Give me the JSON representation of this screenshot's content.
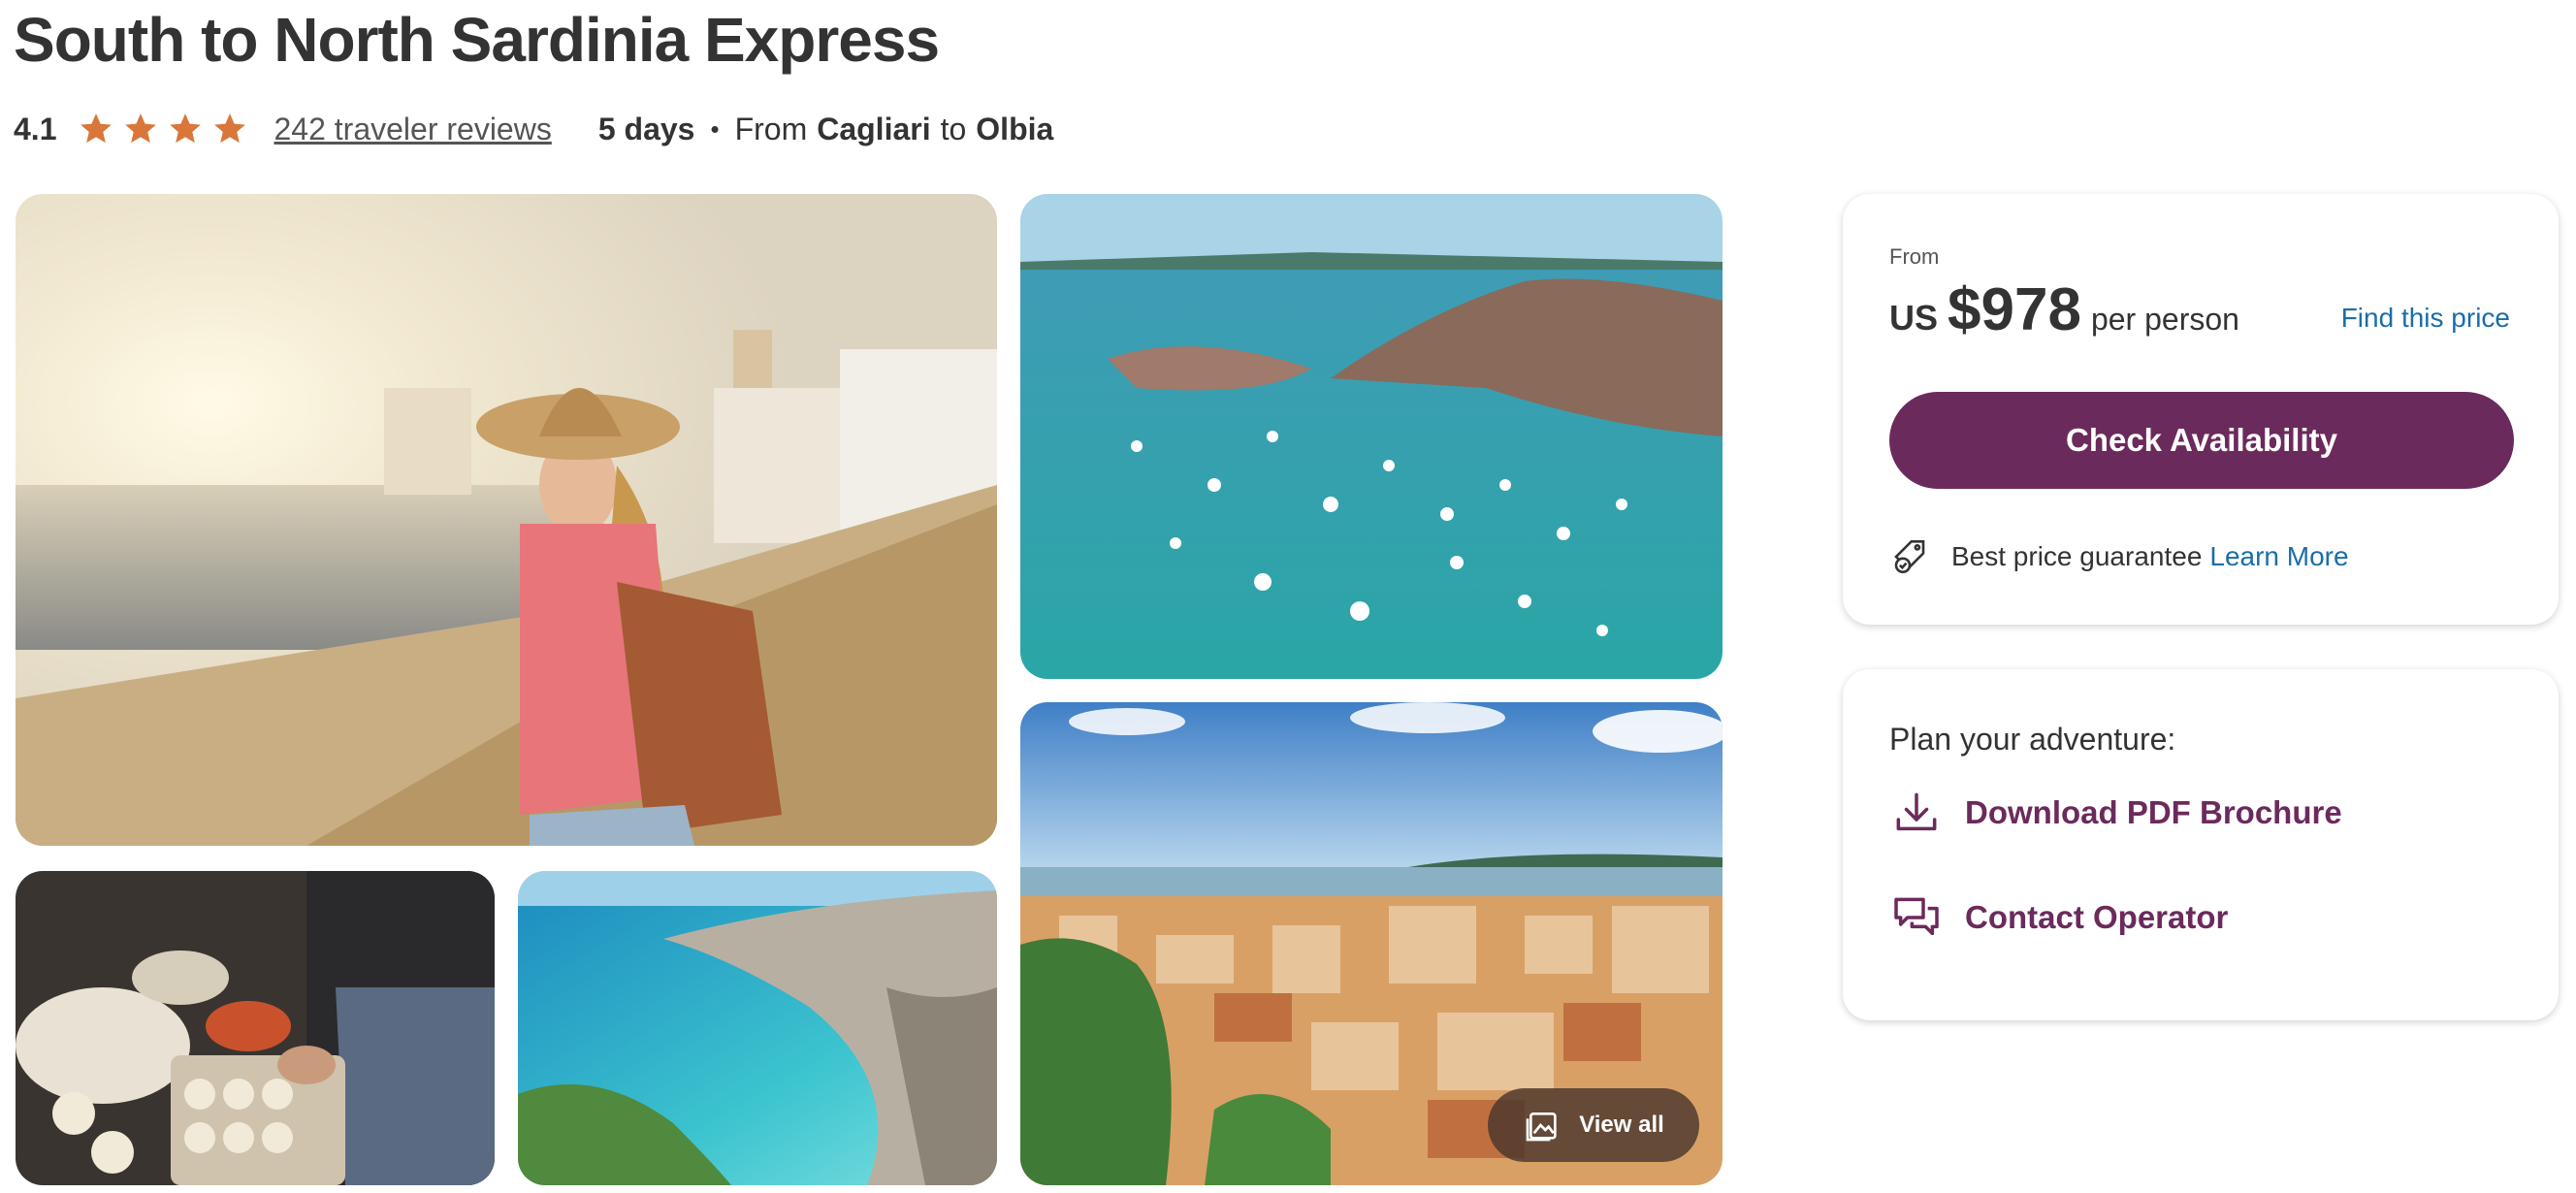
{
  "tour": {
    "title": "South to North Sardinia Express",
    "rating": "4.1",
    "star_count": 4,
    "star_color": "#d9773a",
    "reviews_label": "242 traveler reviews",
    "duration": "5 days",
    "separator": "•",
    "from_word": "From",
    "start_city": "Cagliari",
    "to_word": "to",
    "end_city": "Olbia"
  },
  "gallery": {
    "view_all_label": "View all"
  },
  "pricing": {
    "from_label": "From",
    "currency": "US",
    "amount": "$978",
    "per_label": "per person",
    "find_price_label": "Find this price",
    "check_availability_label": "Check Availability",
    "guarantee_text": "Best price guarantee",
    "learn_more_label": "Learn More",
    "accent_color": "#6b2a5c",
    "link_color": "#1a6ea8"
  },
  "plan": {
    "heading": "Plan your adventure:",
    "download_label": "Download PDF Brochure",
    "contact_label": "Contact Operator"
  }
}
